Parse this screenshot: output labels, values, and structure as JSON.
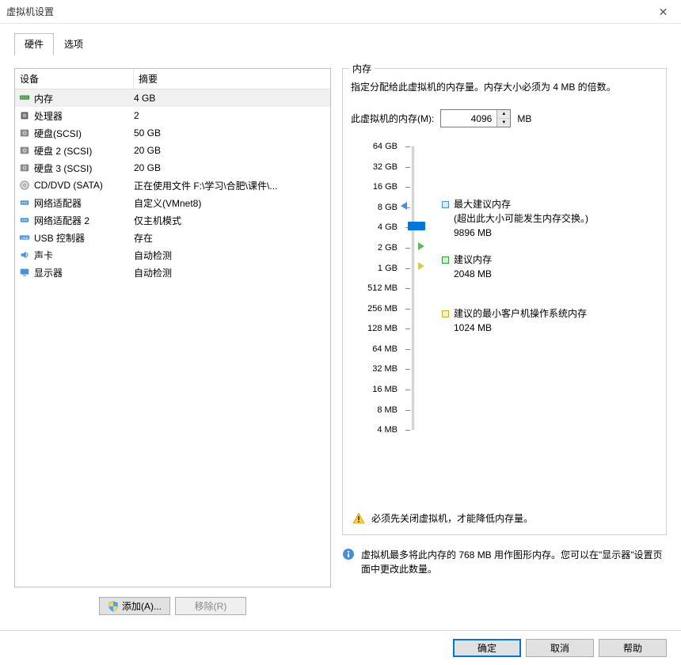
{
  "window": {
    "title": "虚拟机设置"
  },
  "tabs": {
    "hardware": "硬件",
    "options": "选项"
  },
  "table": {
    "headers": {
      "device": "设备",
      "summary": "摘要"
    },
    "rows": [
      {
        "device": "内存",
        "summary": "4 GB",
        "icon": "memory",
        "selected": true
      },
      {
        "device": "处理器",
        "summary": "2",
        "icon": "cpu"
      },
      {
        "device": "硬盘(SCSI)",
        "summary": "50 GB",
        "icon": "disk"
      },
      {
        "device": "硬盘 2 (SCSI)",
        "summary": "20 GB",
        "icon": "disk"
      },
      {
        "device": "硬盘 3 (SCSI)",
        "summary": "20 GB",
        "icon": "disk"
      },
      {
        "device": "CD/DVD (SATA)",
        "summary": "正在使用文件 F:\\学习\\合肥\\课件\\...",
        "icon": "cd"
      },
      {
        "device": "网络适配器",
        "summary": "自定义(VMnet8)",
        "icon": "net"
      },
      {
        "device": "网络适配器 2",
        "summary": "仅主机模式",
        "icon": "net"
      },
      {
        "device": "USB 控制器",
        "summary": "存在",
        "icon": "usb"
      },
      {
        "device": "声卡",
        "summary": "自动检测",
        "icon": "sound"
      },
      {
        "device": "显示器",
        "summary": "自动检测",
        "icon": "display"
      }
    ]
  },
  "left_actions": {
    "add": "添加(A)...",
    "remove": "移除(R)"
  },
  "memory": {
    "legend": "内存",
    "desc": "指定分配给此虚拟机的内存量。内存大小必须为 4 MB 的倍数。",
    "input_label": "此虚拟机的内存(M):",
    "value": "4096",
    "unit": "MB",
    "ticks": [
      "64 GB",
      "32 GB",
      "16 GB",
      "8 GB",
      "4 GB",
      "2 GB",
      "1 GB",
      "512 MB",
      "256 MB",
      "128 MB",
      "64 MB",
      "32 MB",
      "16 MB",
      "8 MB",
      "4 MB"
    ],
    "rec": {
      "max_label": "最大建议内存",
      "max_note": "(超出此大小可能发生内存交换。)",
      "max_value": "9896 MB",
      "suggest_label": "建议内存",
      "suggest_value": "2048 MB",
      "min_label": "建议的最小客户机操作系统内存",
      "min_value": "1024 MB"
    },
    "warn": "必须先关闭虚拟机，才能降低内存量。",
    "info": "虚拟机最多将此内存的 768 MB 用作图形内存。您可以在\"显示器\"设置页面中更改此数量。"
  },
  "footer": {
    "ok": "确定",
    "cancel": "取消",
    "help": "帮助"
  }
}
